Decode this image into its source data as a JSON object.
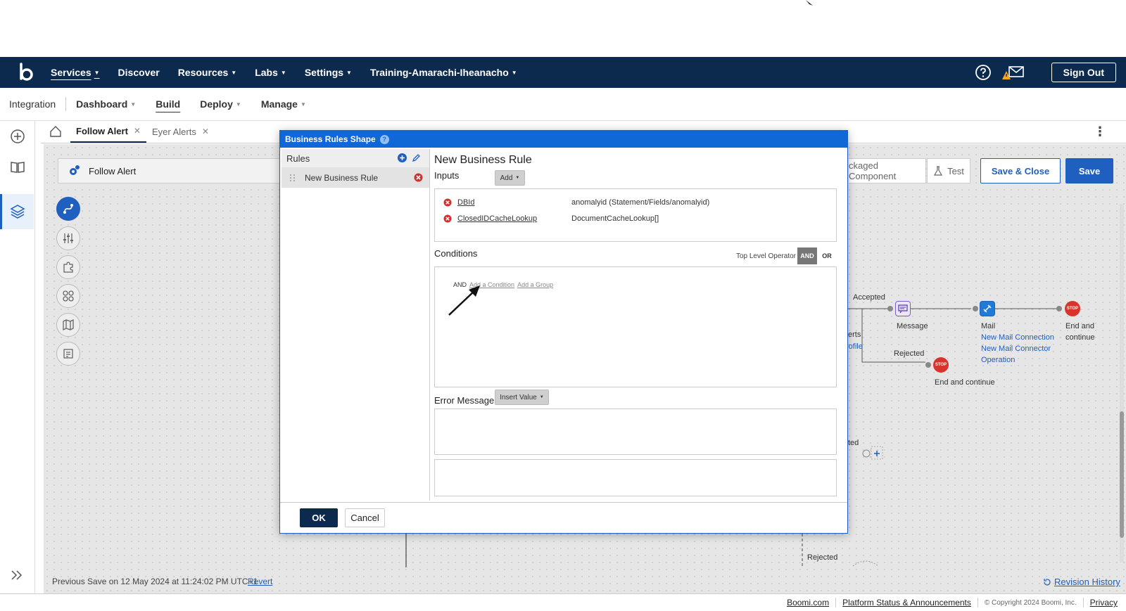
{
  "colors": {
    "navbar": "#0c2a4e",
    "accent": "#1f5fbf",
    "modal_header": "#1068d6",
    "stop": "#d9342b",
    "error": "#d32f2f"
  },
  "navbar": {
    "items": [
      {
        "label": "Services",
        "active": true
      },
      {
        "label": "Discover"
      },
      {
        "label": "Resources"
      },
      {
        "label": "Labs"
      },
      {
        "label": "Settings"
      },
      {
        "label": "Training-Amarachi-Iheanacho"
      }
    ],
    "sign_out": "Sign Out"
  },
  "subnav": {
    "title": "Integration",
    "items": [
      {
        "label": "Dashboard"
      },
      {
        "label": "Build",
        "active": true
      },
      {
        "label": "Deploy"
      },
      {
        "label": "Manage"
      }
    ]
  },
  "tabs": [
    {
      "label": "Follow Alert",
      "active": true
    },
    {
      "label": "Eyer Alerts"
    }
  ],
  "process": {
    "name": "Follow Alert",
    "packaged_component": "ckaged Component",
    "test": "Test",
    "save_close": "Save & Close",
    "save": "Save"
  },
  "canvas": {
    "accepted": "Accepted",
    "message": "Message",
    "mail": "Mail",
    "mail_connection": "New Mail Connection",
    "mail_operation_1": "New Mail Connector",
    "mail_operation_2": "Operation",
    "end_continue_1": "End and",
    "end_continue_2": "continue",
    "rejected": "Rejected",
    "end_and_continue": "End and continue",
    "partial_erts": "erts",
    "partial_rofile": "rofile",
    "partial_ted": "ted",
    "rejected_bottom": "Rejected",
    "stop_text": "STOP"
  },
  "status": {
    "prev_save": "Previous Save on 12 May 2024 at 11:24:02 PM UTC+1",
    "revert": "Revert",
    "revision_history": "Revision History"
  },
  "footer": {
    "boomi": "Boomi.com",
    "platform_status": "Platform Status & Announcements",
    "copyright": "© Copyright 2024 Boomi, Inc.",
    "privacy": "Privacy"
  },
  "modal": {
    "title": "Business Rules Shape",
    "rules_header": "Rules",
    "rules": [
      {
        "label": "New Business Rule"
      }
    ],
    "editor_title": "New Business Rule",
    "inputs_label": "Inputs",
    "add_label": "Add",
    "inputs": [
      {
        "name": "DBId",
        "value": "anomalyid (Statement/Fields/anomalyid)"
      },
      {
        "name": "ClosedIDCacheLookup",
        "value": "DocumentCacheLookup[]"
      }
    ],
    "conditions_label": "Conditions",
    "top_level_operator": "Top Level Operator",
    "and": "AND",
    "or": "OR",
    "cond_and": "AND",
    "add_condition": "Add a Condition",
    "add_group": "Add a Group",
    "error_message_label": "Error Message",
    "insert_value": "Insert Value",
    "ok": "OK",
    "cancel": "Cancel"
  }
}
